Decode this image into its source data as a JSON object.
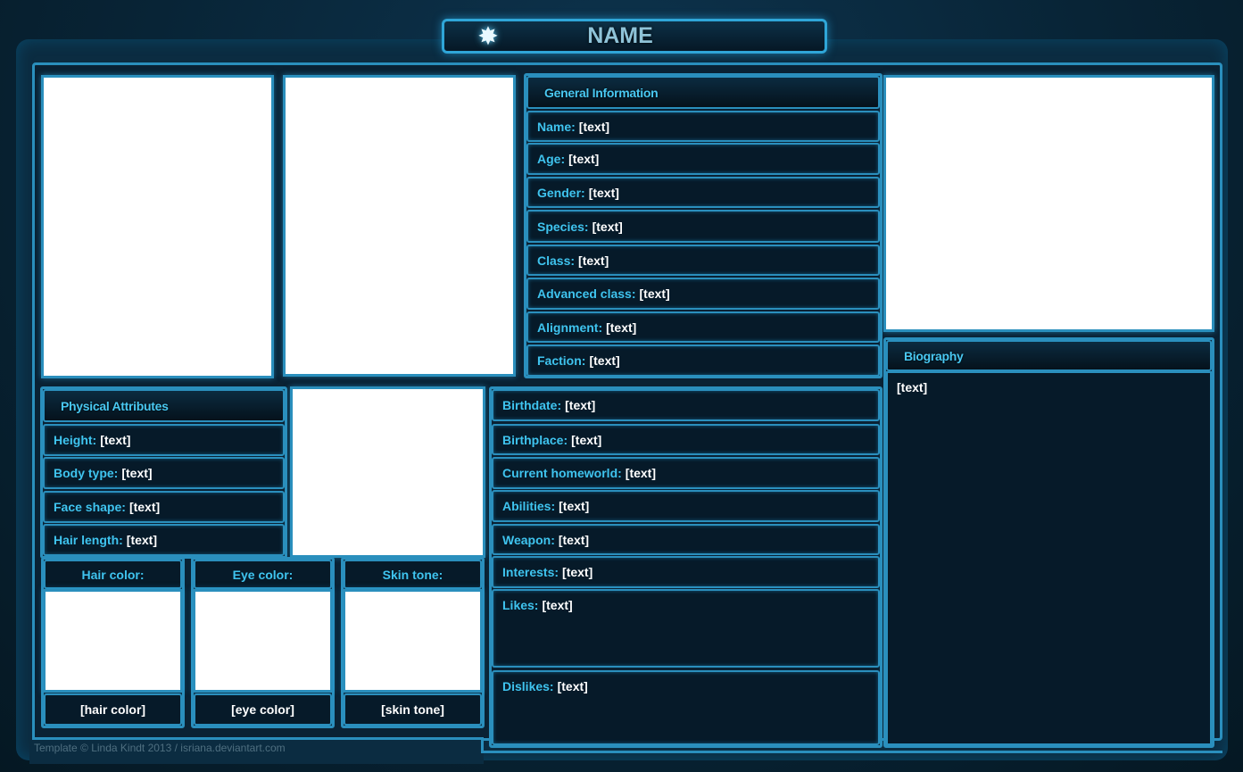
{
  "title": "NAME",
  "general_information": {
    "header": "General Information",
    "fields": [
      {
        "label": "Name:",
        "value": "[text]"
      },
      {
        "label": "Age:",
        "value": "[text]"
      },
      {
        "label": "Gender:",
        "value": "[text]"
      },
      {
        "label": "Species:",
        "value": "[text]"
      },
      {
        "label": "Class:",
        "value": "[text]"
      },
      {
        "label": "Advanced class:",
        "value": "[text]"
      },
      {
        "label": "Alignment:",
        "value": "[text]"
      },
      {
        "label": "Faction:",
        "value": "[text]"
      }
    ]
  },
  "physical_attributes": {
    "header": "Physical Attributes",
    "fields": [
      {
        "label": "Height:",
        "value": "[text]"
      },
      {
        "label": "Body type:",
        "value": "[text]"
      },
      {
        "label": "Face shape:",
        "value": "[text]"
      },
      {
        "label": "Hair length:",
        "value": "[text]"
      }
    ]
  },
  "swatches": [
    {
      "label": "Hair color:",
      "value": "[hair color]"
    },
    {
      "label": "Eye color:",
      "value": "[eye color]"
    },
    {
      "label": "Skin tone:",
      "value": "[skin tone]"
    }
  ],
  "details": {
    "fields": [
      {
        "label": "Birthdate:",
        "value": "[text]"
      },
      {
        "label": "Birthplace:",
        "value": "[text]"
      },
      {
        "label": "Current homeworld:",
        "value": "[text]"
      },
      {
        "label": "Abilities:",
        "value": "[text]"
      },
      {
        "label": "Weapon:",
        "value": "[text]"
      },
      {
        "label": "Interests:",
        "value": "[text]"
      },
      {
        "label": "Likes:",
        "value": "[text]"
      },
      {
        "label": "Dislikes:",
        "value": "[text]"
      }
    ]
  },
  "biography": {
    "header": "Biography",
    "value": "[text]"
  },
  "footer": "Template © Linda Kindt 2013 / isriana.deviantart.com",
  "colors": {
    "accent": "#2a8fbd",
    "label": "#3fc4ef",
    "background": "#0b2c41"
  },
  "icons": {
    "title_emblem": "star-icon"
  }
}
